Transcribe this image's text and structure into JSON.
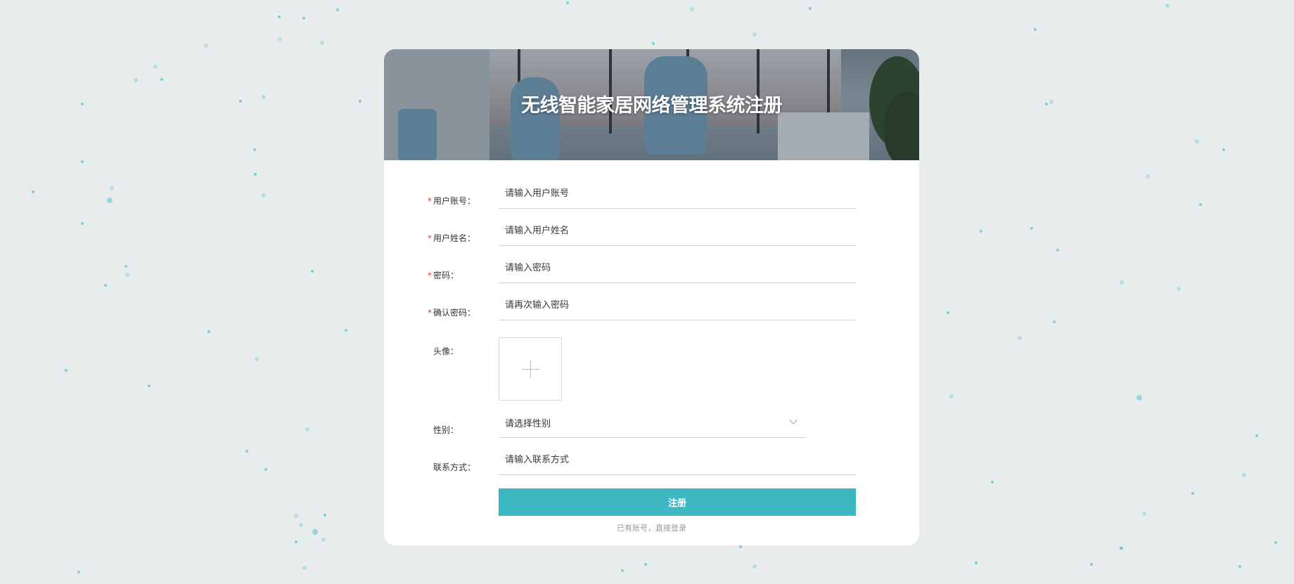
{
  "page": {
    "title": "无线智能家居网络管理系统注册"
  },
  "form": {
    "account": {
      "label": "用户账号",
      "required": true,
      "placeholder": "请输入用户账号"
    },
    "name": {
      "label": "用户姓名",
      "required": true,
      "placeholder": "请输入用户姓名"
    },
    "password": {
      "label": "密码",
      "required": true,
      "placeholder": "请输入密码"
    },
    "confirm_password": {
      "label": "确认密码",
      "required": true,
      "placeholder": "请再次输入密码"
    },
    "avatar": {
      "label": "头像",
      "required": false,
      "icon": "plus-icon"
    },
    "gender": {
      "label": "性别",
      "required": false,
      "placeholder": "请选择性别",
      "icon": "chevron-down-icon"
    },
    "contact": {
      "label": "联系方式",
      "required": false,
      "placeholder": "请输入联系方式"
    },
    "required_mark": "*",
    "colon": "："
  },
  "actions": {
    "submit_label": "注册",
    "login_link": "已有账号，直接登录"
  },
  "colors": {
    "accent": "#3db8c3",
    "required": "#e53935",
    "background": "#e9ecec"
  }
}
